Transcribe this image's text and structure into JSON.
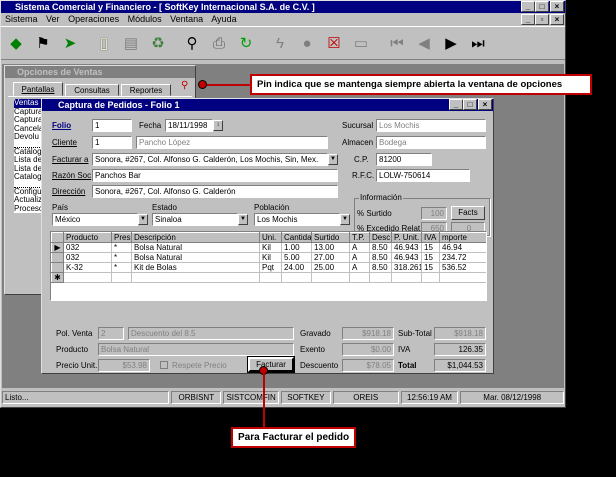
{
  "app": {
    "title": "Sistema Comercial y Financiero - [ SoftKey Internacional S.A. de C.V. ]",
    "menu": [
      "Sistema",
      "Ver",
      "Operaciones",
      "Módulos",
      "Ventana",
      "Ayuda"
    ]
  },
  "toolbar": {
    "icons": [
      "green-arrow-icon",
      "checkered-flag-icon",
      "forward-arrow-icon",
      "new-document-icon",
      "cabinet-icon",
      "recycle-bin-icon",
      "binoculars-icon",
      "printer-icon",
      "refresh-icon",
      "lightning-icon",
      "disabled-icon",
      "cancel-document-icon",
      "cancel-message-icon",
      "first-record-icon",
      "previous-record-icon",
      "next-record-icon",
      "last-record-icon"
    ]
  },
  "options_window": {
    "title": "Opciones de Ventas",
    "tabs": [
      "Pantallas",
      "Consultas",
      "Reportes"
    ],
    "items": [
      "Ventas",
      "Captura",
      "Captura",
      "Cancela",
      "Devolu",
      "Catálog",
      "Lista de",
      "Lista de",
      "Catalog",
      "Configu",
      "Actualiz",
      "Proceso"
    ]
  },
  "order_window": {
    "title": "Captura de Pedidos - Folio 1",
    "folio_label": "Folio",
    "folio": "1",
    "fecha_label": "Fecha",
    "fecha": "18/11/1998",
    "sucursal_label": "Sucursal",
    "sucursal": "Los Mochis",
    "cliente_label": "Cliente",
    "cliente_num": "1",
    "cliente_nombre": "Pancho López",
    "almacen_label": "Almacen",
    "almacen": "Bodega",
    "facturar_label": "Facturar a",
    "facturar": "Sonora, #267, Col. Alfonso G. Calderón, Los Mochis, Sin, Mex.",
    "cp_label": "C.P.",
    "cp": "81200",
    "razon_label": "Razón Soc",
    "razon": "Panchos Bar",
    "rfc_label": "R.F.C.",
    "rfc": "LOLW-750614",
    "direccion_label": "Dirección",
    "direccion": "Sonora, #267, Col. Alfonso G. Calderón",
    "pais_label": "País",
    "pais": "México",
    "estado_label": "Estado",
    "estado": "Sinaloa",
    "poblacion_label": "Población",
    "poblacion": "Los Mochis",
    "info_label": "Información",
    "surtido_label": "% Surtido",
    "surtido": "100",
    "excedido_label": "% Excedido Relat.",
    "excedido": "650",
    "facts_label": "Facts",
    "facts_val": "0",
    "columns": [
      "Producto",
      "Pres.",
      "Descripción",
      "Uni.",
      "Cantidad",
      "Surtido",
      "T.P.",
      "Desc.",
      "P. Unit.",
      "IVA",
      "mporte"
    ],
    "rows": [
      [
        "032",
        "*",
        "Bolsa Natural",
        "Kil",
        "1.00",
        "13.00",
        "A",
        "8.50",
        "46.943",
        "15",
        "46.94"
      ],
      [
        "032",
        "*",
        "Bolsa Natural",
        "Kil",
        "5.00",
        "27.00",
        "A",
        "8.50",
        "46.943",
        "15",
        "234.72"
      ],
      [
        "K-32",
        "*",
        "Kit de Bolas",
        "Pqt",
        "24.00",
        "25.00",
        "A",
        "8.50",
        "318.261",
        "15",
        "536.52"
      ]
    ],
    "pol_venta_label": "Pol. Venta",
    "pol_venta": "2",
    "pol_desc": "Descuento del 8.5",
    "producto_label": "Producto",
    "producto": "Bolsa Natural",
    "precio_label": "Precio Unit.",
    "precio": "$53.98",
    "respete_label": "Respete Precio",
    "facturar_btn": "Facturar",
    "gravado_label": "Gravado",
    "gravado": "$918.18",
    "exento_label": "Exento",
    "exento": "$0.00",
    "descuento_label": "Descuento",
    "descuento": "$78.05",
    "subtotal_label": "Sub-Total",
    "subtotal": "$918.18",
    "iva_label": "IVA",
    "iva": "126.35",
    "total_label": "Total",
    "total": "$1,044.53"
  },
  "status": [
    "Listo...",
    "ORBISNT",
    "SISTCOMFIN",
    "SOFTKEY",
    "OREIS",
    "12:56:19 AM",
    "Mar. 08/12/1998"
  ],
  "callouts": {
    "pin": "Pin indica que se mantenga siempre abierta la ventana de opciones",
    "facturar": "Para Facturar el pedido"
  }
}
